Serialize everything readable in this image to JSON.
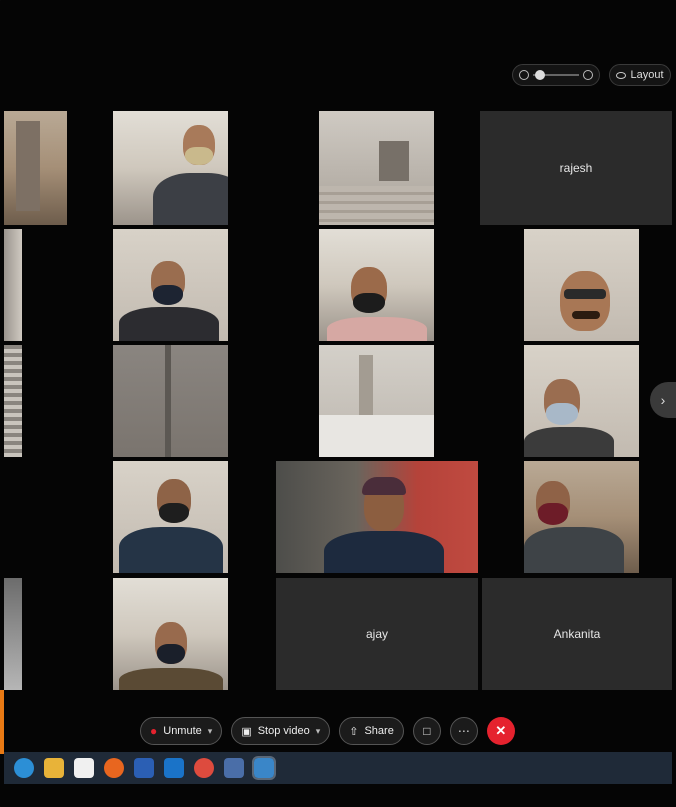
{
  "top_controls": {
    "layout_label": "Layout"
  },
  "participants": {
    "rajesh": "rajesh",
    "ajay": "ajay",
    "ankanita": "Ankanita"
  },
  "toolbar": {
    "unmute_label": "Unmute",
    "stop_video_label": "Stop video",
    "share_label": "Share"
  },
  "colors": {
    "leave_red": "#e5222e",
    "tile_gray": "#2b2b2b",
    "taskbar": "#1f2a38"
  },
  "icons": {
    "zoom_out": "zoom-out-icon",
    "zoom_in": "zoom-in-icon",
    "layout": "eye-icon",
    "next": "chevron-right-icon",
    "unmute": "mic-muted-icon",
    "video": "video-camera-icon",
    "share": "share-screen-icon",
    "reactions": "reaction-icon",
    "more": "more-icon",
    "leave": "close-icon"
  }
}
